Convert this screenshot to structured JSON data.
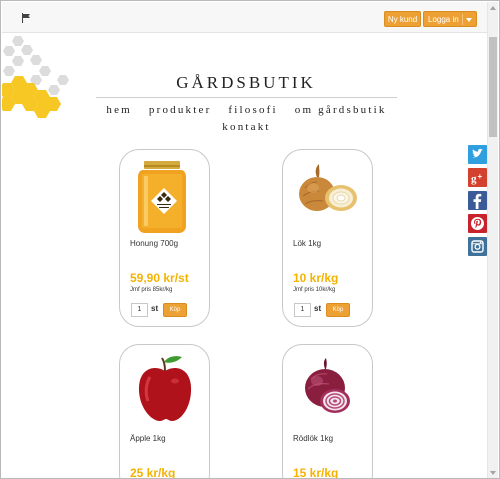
{
  "topbar": {
    "new_customer_label": "Ny kund",
    "login_label": "Logga in"
  },
  "site": {
    "title": "GÅRDSBUTIK"
  },
  "nav": {
    "items": [
      "hem",
      "produkter",
      "filosofi",
      "om gårdsbutik",
      "kontakt"
    ]
  },
  "social": [
    "twitter-icon",
    "google-plus-icon",
    "facebook-icon",
    "pinterest-icon",
    "instagram-icon"
  ],
  "products": [
    {
      "name": "Honung 700g",
      "price": "59,90 kr/st",
      "compare": "Jmf pris 85kr/kg",
      "qty": "1",
      "unit": "st",
      "buy": "Köp"
    },
    {
      "name": "Lök 1kg",
      "price": "10 kr/kg",
      "compare": "Jmf pris 10kr/kg",
      "qty": "1",
      "unit": "st",
      "buy": "Köp"
    },
    {
      "name": "Äpple 1kg",
      "price": "25 kr/kg"
    },
    {
      "name": "Rödlök 1kg",
      "price": "15 kr/kg"
    }
  ],
  "colors": {
    "accent": "#eda135",
    "price": "#f5b301",
    "honeycomb_yellow": "#f7c823",
    "honeycomb_gray": "#d8d8d8"
  }
}
